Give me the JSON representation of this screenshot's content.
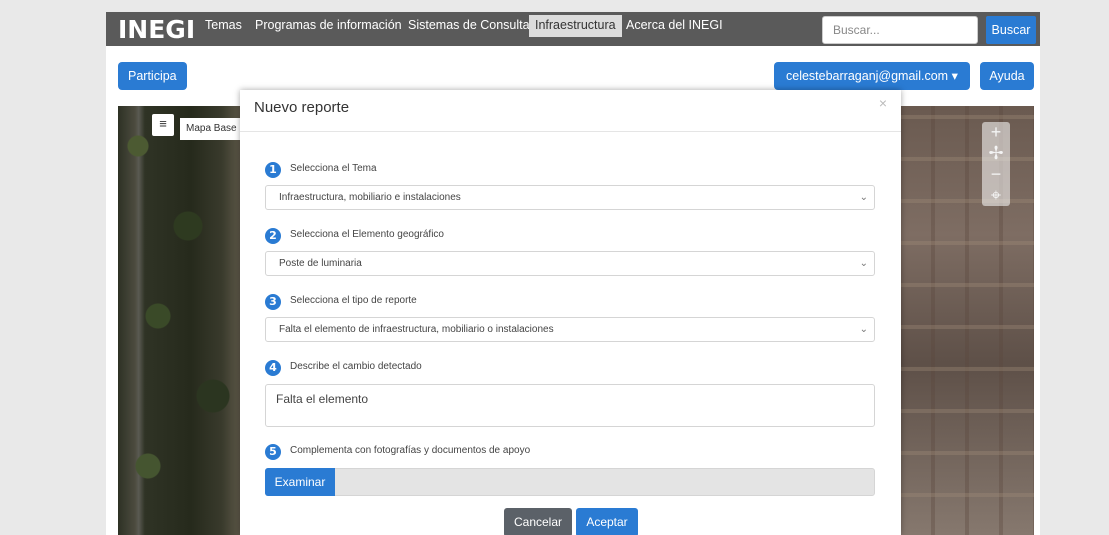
{
  "navbar": {
    "logo": "INEGI",
    "items": [
      {
        "label": "Temas"
      },
      {
        "label": "Programas de información"
      },
      {
        "label": "Sistemas de Consulta"
      },
      {
        "label": "Infraestructura"
      },
      {
        "label": "Acerca del INEGI"
      }
    ],
    "active_item": "Infraestructura",
    "search_placeholder": "Buscar...",
    "search_button": "Buscar"
  },
  "toolbar": {
    "participa": "Participa",
    "user_email": "celestebarraganj@gmail.com",
    "user_caret": "▾",
    "ayuda": "Ayuda"
  },
  "map": {
    "layers_icon": "≡",
    "base_map_label": "Mapa Base",
    "zoom_in": "+",
    "pan": "✢",
    "zoom_out": "−",
    "locate": "⌖"
  },
  "modal": {
    "title": "Nuevo reporte",
    "close": "×",
    "steps": [
      {
        "num": "1",
        "label": "Selecciona el Tema",
        "value": "Infraestructura, mobiliario e instalaciones"
      },
      {
        "num": "2",
        "label": "Selecciona el Elemento geográfico",
        "value": "Poste de luminaria"
      },
      {
        "num": "3",
        "label": "Selecciona el tipo de reporte",
        "value": "Falta el elemento de infraestructura, mobiliario o instalaciones"
      },
      {
        "num": "4",
        "label": "Describe el cambio detectado",
        "value": "Falta el elemento"
      },
      {
        "num": "5",
        "label": "Complementa con fotografías y documentos de apoyo"
      }
    ],
    "browse_button": "Examinar",
    "cancel_button": "Cancelar",
    "accept_button": "Aceptar"
  },
  "colors": {
    "navbar_bg": "#5a5a5a",
    "accent": "#2a7bd3",
    "cancel_bg": "#5b6168"
  }
}
